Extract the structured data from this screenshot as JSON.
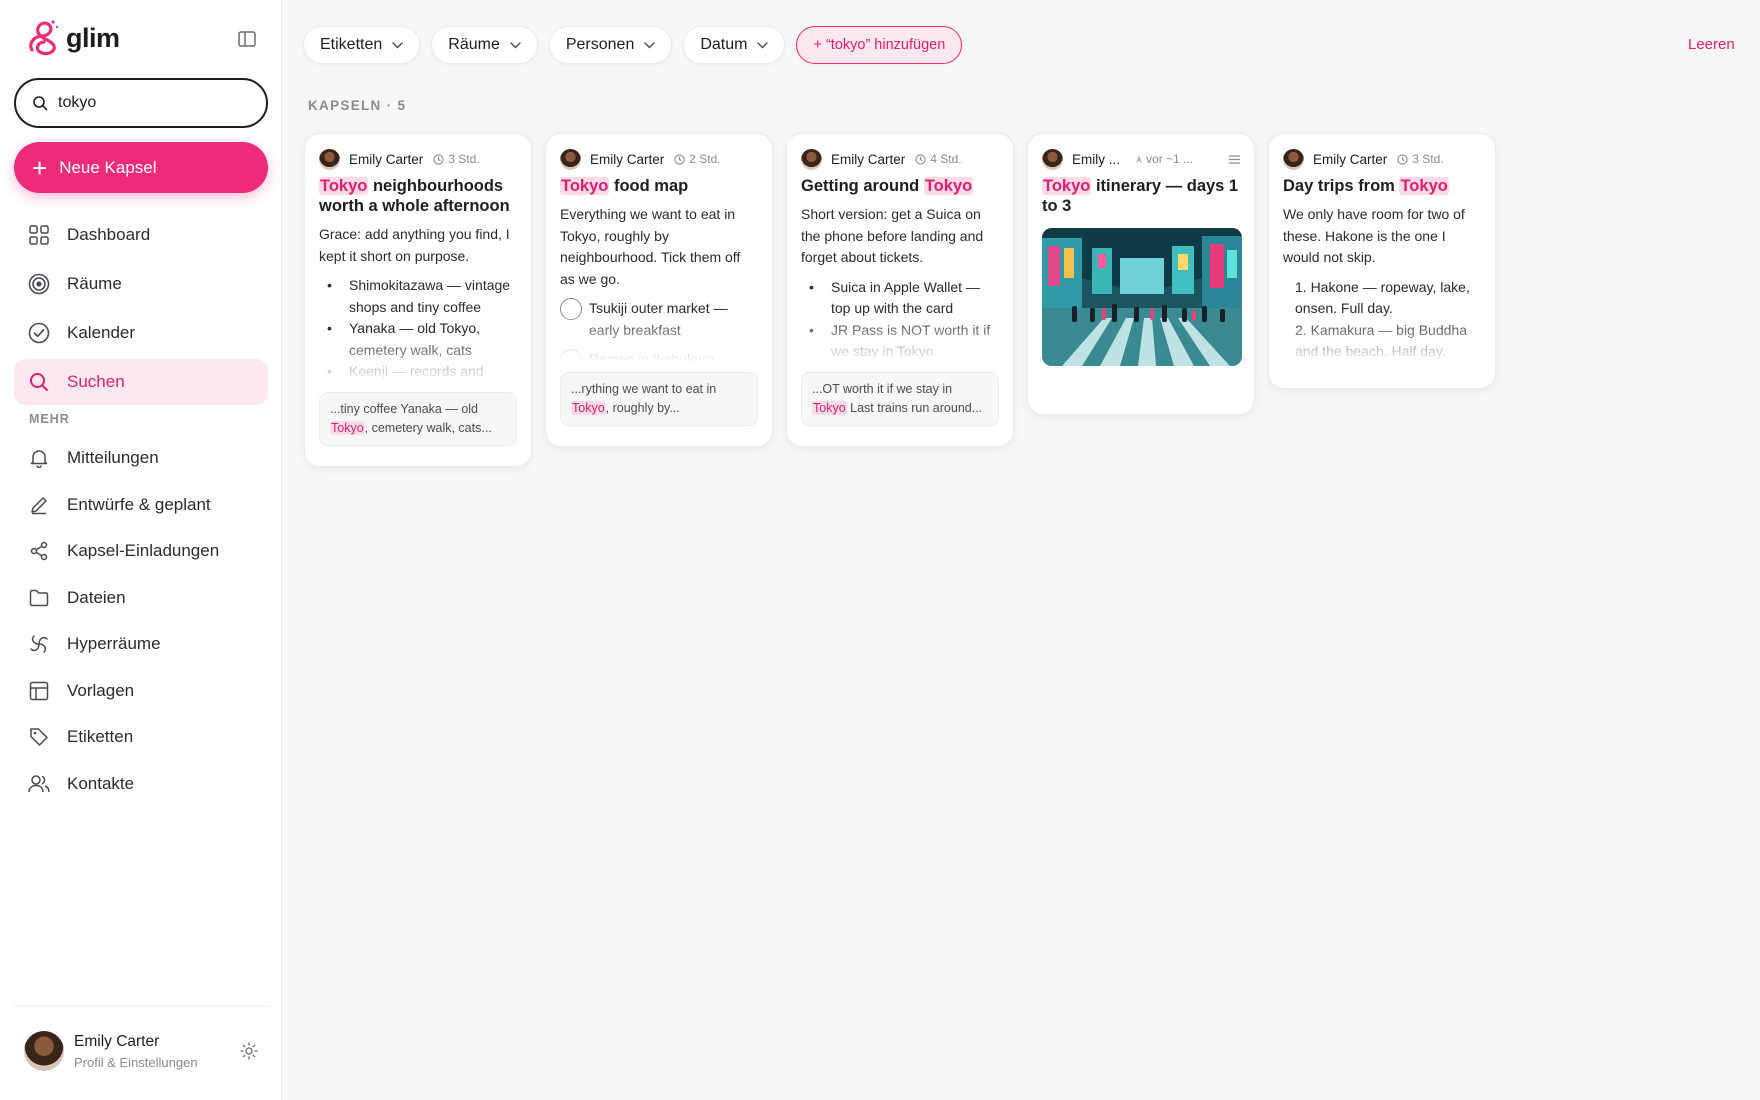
{
  "app": {
    "name": "glim"
  },
  "search": {
    "value": "tokyo"
  },
  "new_capsule": {
    "label": "Neue Kapsel"
  },
  "nav": [
    {
      "label": "Dashboard",
      "icon": "grid-icon"
    },
    {
      "label": "Räume",
      "icon": "rooms-icon"
    },
    {
      "label": "Kalender",
      "icon": "check-circle-icon"
    },
    {
      "label": "Suchen",
      "icon": "search-icon",
      "active": true
    }
  ],
  "more": {
    "label": "MEHR",
    "items": [
      {
        "label": "Mitteilungen",
        "icon": "bell-icon"
      },
      {
        "label": "Entwürfe & geplant",
        "icon": "pencil-icon"
      },
      {
        "label": "Kapsel-Einladungen",
        "icon": "share-icon"
      },
      {
        "label": "Dateien",
        "icon": "folder-icon"
      },
      {
        "label": "Hyperräume",
        "icon": "hyperspace-icon"
      },
      {
        "label": "Vorlagen",
        "icon": "template-icon"
      },
      {
        "label": "Etiketten",
        "icon": "tag-icon"
      },
      {
        "label": "Kontakte",
        "icon": "contacts-icon"
      }
    ]
  },
  "profile": {
    "name": "Emily Carter",
    "subtitle": "Profil & Einstellungen"
  },
  "filters": [
    {
      "label": "Etiketten"
    },
    {
      "label": "Räume"
    },
    {
      "label": "Personen"
    },
    {
      "label": "Datum"
    }
  ],
  "add_filter": {
    "label": "+ “tokyo” hinzufügen"
  },
  "clear": {
    "label": "Leeren"
  },
  "results": {
    "header": "KAPSELN · 5"
  },
  "cards": [
    {
      "author": "Emily Carter",
      "time": "3 Std.",
      "title_hl": "Tokyo",
      "title_rest": " neighbourhoods worth a whole afternoon",
      "body": "Grace: add anything you find, I kept it short on purpose.",
      "bullets": [
        "Shimokitazawa — vintage shops and tiny coffee",
        "Yanaka — old Tokyo, cemetery walk, cats",
        "Koenji — records and"
      ],
      "snippet_pre": "...tiny coffee Yanaka — old ",
      "snippet_hl": "Tokyo",
      "snippet_post": ", cemetery walk, cats..."
    },
    {
      "author": "Emily Carter",
      "time": "2 Std.",
      "title_hl": "Tokyo",
      "title_rest": " food map",
      "body": "Everything we want to eat in Tokyo, roughly by neighbourhood. Tick them off as we go.",
      "checks": [
        "Tsukiji outer market — early breakfast",
        "Ramen in Ikebukuro"
      ],
      "snippet_pre": "...rything we want to eat in ",
      "snippet_hl": "Tokyo",
      "snippet_post": ", roughly by..."
    },
    {
      "author": "Emily Carter",
      "time": "4 Std.",
      "title_pre": "Getting around ",
      "title_hl": "Tokyo",
      "body": "Short version: get a Suica on the phone before landing and forget about tickets.",
      "bullets": [
        "Suica in Apple Wallet — top up with the card",
        "JR Pass is NOT worth it if we stay in Tokyo"
      ],
      "snippet_pre": "...OT worth it if we stay in ",
      "snippet_hl": "Tokyo",
      "snippet_post": " Last trains run around..."
    },
    {
      "author": "Emily ...",
      "time": "vor ~1 ...",
      "title_hl": "Tokyo",
      "title_rest": " itinerary — days 1 to 3",
      "photo": "shibuya-street-photo"
    },
    {
      "author": "Emily Carter",
      "time": "3 Std.",
      "title_pre": "Day trips from ",
      "title_hl": "Tokyo",
      "body": "We only have room for two of these. Hakone is the one I would not skip.",
      "numbered": [
        "1.  Hakone — ropeway, lake, onsen. Full day.",
        "2.  Kamakura — big Buddha and the beach. Half day."
      ]
    }
  ],
  "colors": {
    "accent": "#ee2a79",
    "highlight_bg": "#fcdbe8",
    "active_nav_bg": "#fde8ef"
  }
}
